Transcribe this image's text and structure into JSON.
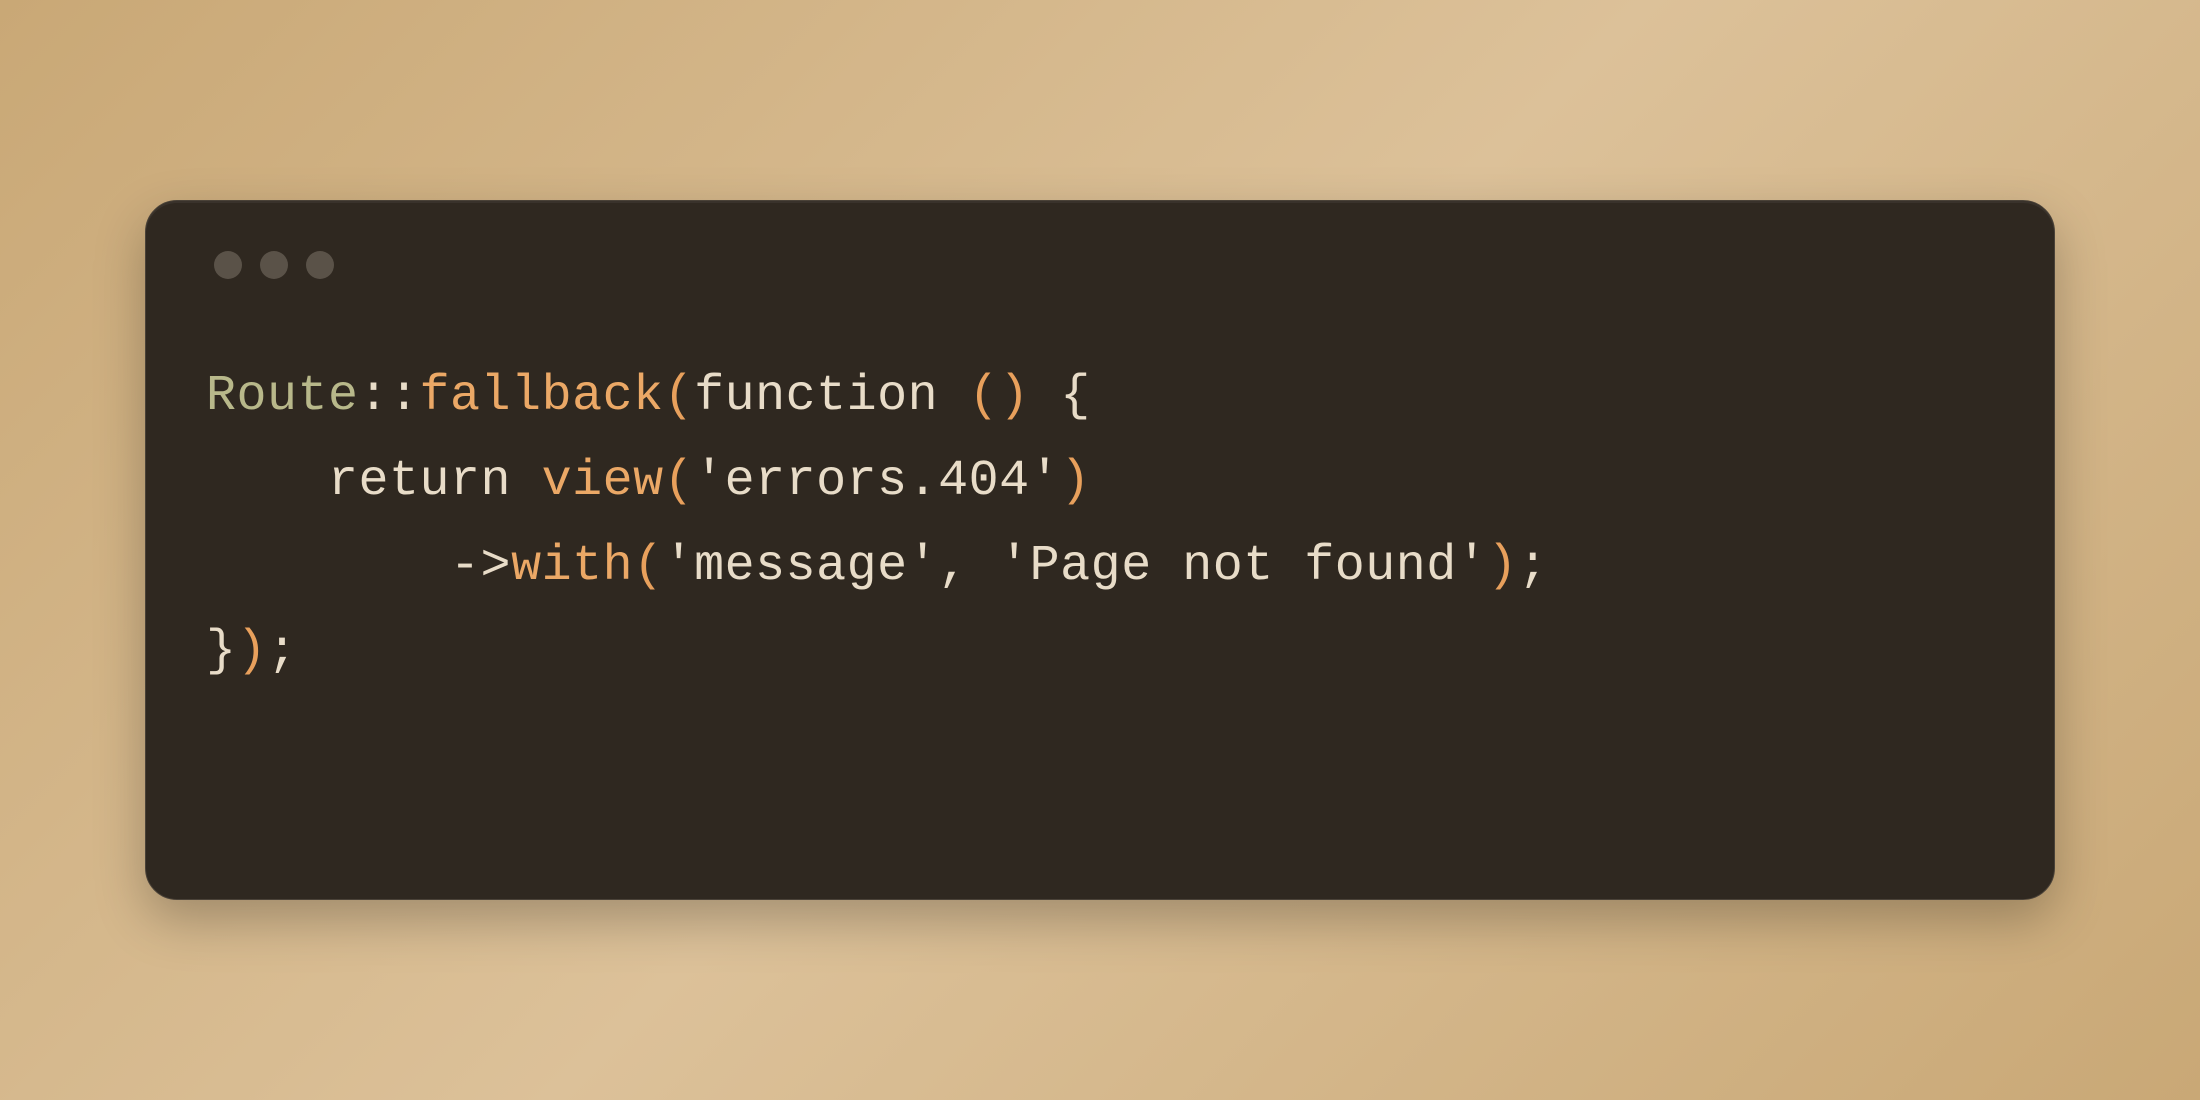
{
  "code": {
    "lines": [
      {
        "indent": "",
        "tokens": [
          {
            "class": "tk-class",
            "text": "Route"
          },
          {
            "class": "tk-operator",
            "text": "::"
          },
          {
            "class": "tk-method",
            "text": "fallback"
          },
          {
            "class": "tk-paren",
            "text": "("
          },
          {
            "class": "tk-keyword",
            "text": "function "
          },
          {
            "class": "tk-paren",
            "text": "()"
          },
          {
            "class": "tk-default",
            "text": " "
          },
          {
            "class": "tk-brace",
            "text": "{"
          }
        ]
      },
      {
        "indent": "    ",
        "tokens": [
          {
            "class": "tk-keyword",
            "text": "return "
          },
          {
            "class": "tk-method",
            "text": "view"
          },
          {
            "class": "tk-paren",
            "text": "("
          },
          {
            "class": "tk-string",
            "text": "'errors.404'"
          },
          {
            "class": "tk-paren",
            "text": ")"
          }
        ]
      },
      {
        "indent": "        ",
        "tokens": [
          {
            "class": "tk-operator",
            "text": "->"
          },
          {
            "class": "tk-method",
            "text": "with"
          },
          {
            "class": "tk-paren",
            "text": "("
          },
          {
            "class": "tk-string",
            "text": "'message'"
          },
          {
            "class": "tk-punct",
            "text": ", "
          },
          {
            "class": "tk-string",
            "text": "'Page not found'"
          },
          {
            "class": "tk-paren",
            "text": ")"
          },
          {
            "class": "tk-punct",
            "text": ";"
          }
        ]
      },
      {
        "indent": "",
        "tokens": [
          {
            "class": "tk-brace",
            "text": "}"
          },
          {
            "class": "tk-paren",
            "text": ")"
          },
          {
            "class": "tk-punct",
            "text": ";"
          }
        ]
      }
    ]
  },
  "window": {
    "dot_count": 3
  }
}
